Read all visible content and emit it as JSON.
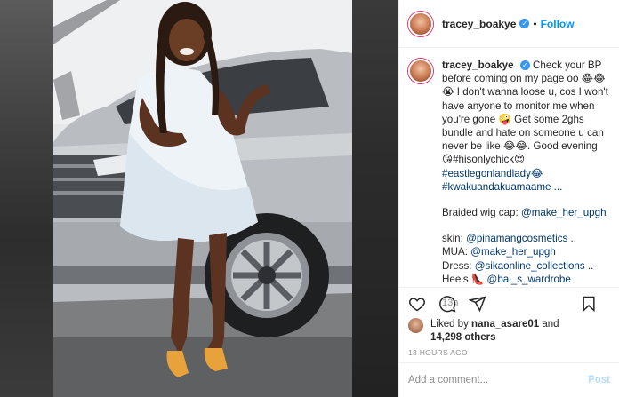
{
  "post": {
    "username": "tracey_boakye",
    "follow_label": "Follow",
    "dot": "•"
  },
  "caption": {
    "lines": [
      "Check your BP before coming on my page oo 😂😂",
      "😭 I don't wanna loose u, cos I won't have anyone to monitor me when you're gone 🤪 Get some 2ghs bundle and hate on someone u can never be like 😂😂. Good evening 😘#hisonlychick😍",
      "#eastlegonlandlady😂",
      "#kwakuandakuamaame ..."
    ],
    "credits": [
      {
        "label": "Braided wig cap:",
        "handle": "@make_her_upgh"
      },
      {
        "label": "skin:",
        "handle": "@pinamangcosmetics",
        "suffix": " .."
      },
      {
        "label": "MUA:",
        "handle": "@make_her_upgh"
      },
      {
        "label": "Dress:",
        "handle": "@sikaonline_collections",
        "suffix": " .."
      },
      {
        "label": "Heels 👠",
        "handle": "@bai_s_wardrobe"
      }
    ],
    "time": "13h"
  },
  "likes": {
    "prefix": "Liked by",
    "user": "nana_asare01",
    "and": "and",
    "count": "14,298 others"
  },
  "posted_ago": "13 HOURS AGO",
  "comment": {
    "placeholder": "Add a comment...",
    "post_label": "Post"
  },
  "colors": {
    "link": "#00376b",
    "follow": "#0095f6",
    "verified": "#3897f0"
  }
}
